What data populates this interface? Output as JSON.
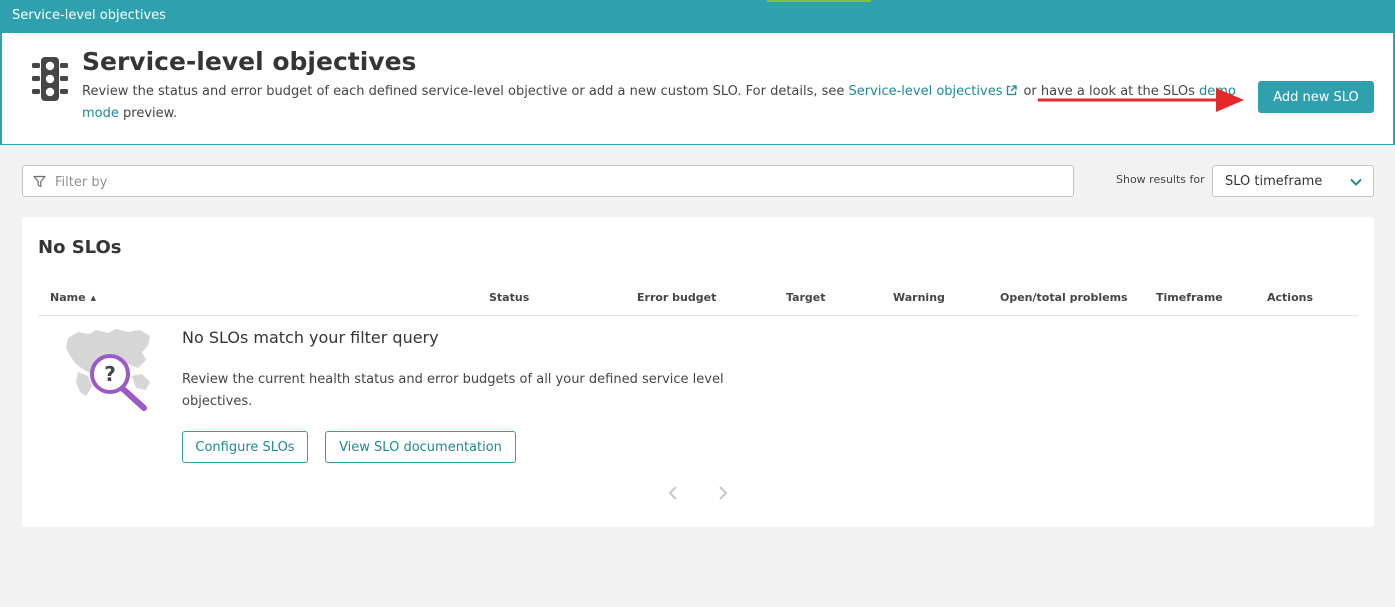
{
  "topbar": {
    "title": "Service-level objectives"
  },
  "header": {
    "icon": "traffic-light-icon",
    "title": "Service-level objectives",
    "desc_part1": "Review the status and error budget of each defined service-level objective or add a new custom SLO. For details, see ",
    "doc_link": "Service-level objectives",
    "desc_part2": "or have a look at the SLOs ",
    "demo_link": "demo mode",
    "desc_part3": " preview.",
    "add_button": "Add new SLO"
  },
  "filter": {
    "icon": "filter-icon",
    "placeholder": "Filter by"
  },
  "results": {
    "label": "Show results for",
    "selected": "SLO timeframe"
  },
  "card": {
    "title": "No SLOs",
    "columns": [
      "Name",
      "Status",
      "Error budget",
      "Target",
      "Warning",
      "Open/total problems",
      "Timeframe",
      "Actions"
    ],
    "empty_title": "No SLOs match your filter query",
    "empty_desc": "Review the current health status and error budgets of all your defined service level objectives.",
    "configure_button": "Configure SLOs",
    "docs_button": "View SLO documentation"
  },
  "colors": {
    "brand": "#2fa0ad",
    "link": "#1e8a97",
    "arrow": "#e5282a"
  }
}
